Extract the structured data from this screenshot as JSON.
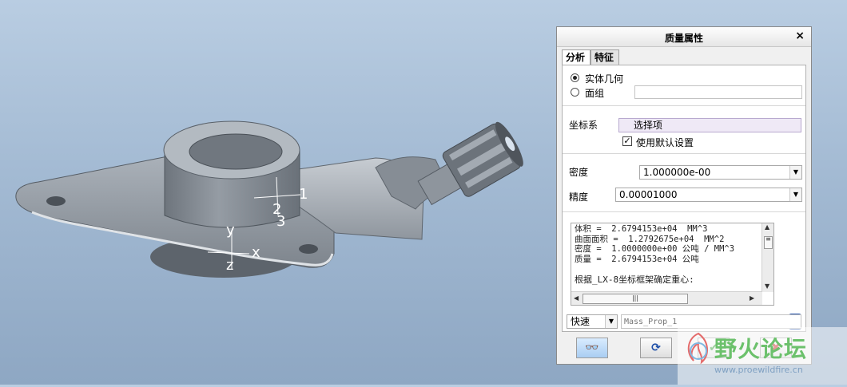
{
  "dialog": {
    "title": "质量属性",
    "close": "×",
    "tabs": [
      "分析",
      "特征"
    ],
    "geometry": {
      "option_solid": "实体几何",
      "option_quilt": "面组"
    },
    "coord_sys": {
      "label": "坐标系",
      "selector": "选择项",
      "use_default": "使用默认设置"
    },
    "density": {
      "label": "密度",
      "value": "1.000000e-00"
    },
    "precision": {
      "label": "精度",
      "value": "0.00001000"
    },
    "results": {
      "lines": [
        "体积 =  2.6794153e+04  MM^3",
        "曲面面积 =  1.2792675e+04  MM^2",
        "密度 =  1.0000000e+00 公吨 / MM^3",
        "质量 =  2.6794153e+04 公吨",
        "",
        "根据_LX-8坐标框架确定重心:"
      ]
    },
    "mode": {
      "value": "快速"
    },
    "name_field": {
      "placeholder": "Mass_Prop_1"
    }
  },
  "viewport": {
    "triad_labels": [
      "1",
      "2",
      "3",
      "y",
      "x",
      "z"
    ]
  },
  "watermark": {
    "title": "野火论坛",
    "url": "www.proewildfire.cn"
  }
}
